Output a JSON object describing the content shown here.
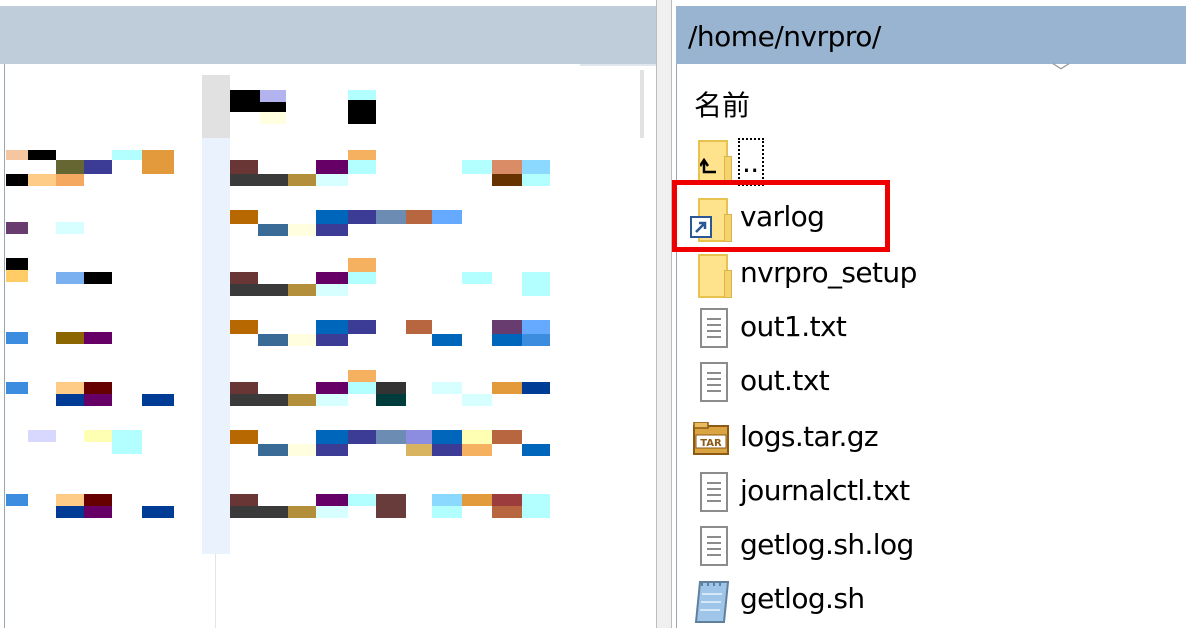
{
  "remote_panel": {
    "path": "/home/nvrpro/",
    "column_header": "名前",
    "sort_icon": "chevron-down-icon",
    "files": [
      {
        "name": "..",
        "type": "parent-folder",
        "icon": "parent-folder-icon"
      },
      {
        "name": "varlog",
        "type": "folder-shortcut",
        "icon": "shortcut-folder-icon"
      },
      {
        "name": "nvrpro_setup",
        "type": "folder",
        "icon": "folder-icon"
      },
      {
        "name": "out1.txt",
        "type": "file",
        "icon": "text-file-icon"
      },
      {
        "name": "out.txt",
        "type": "file",
        "icon": "text-file-icon"
      },
      {
        "name": "logs.tar.gz",
        "type": "archive",
        "icon": "tar-archive-icon",
        "icon_text": "TAR"
      },
      {
        "name": "journalctl.txt",
        "type": "file",
        "icon": "text-file-icon"
      },
      {
        "name": "getlog.sh.log",
        "type": "file",
        "icon": "text-file-icon"
      },
      {
        "name": "getlog.sh",
        "type": "script",
        "icon": "script-file-icon"
      }
    ],
    "highlighted_item": "varlog",
    "highlight_color": "#ee0000"
  },
  "colors": {
    "path_bar": "#99b4d1",
    "left_header": "#bfcddb"
  }
}
